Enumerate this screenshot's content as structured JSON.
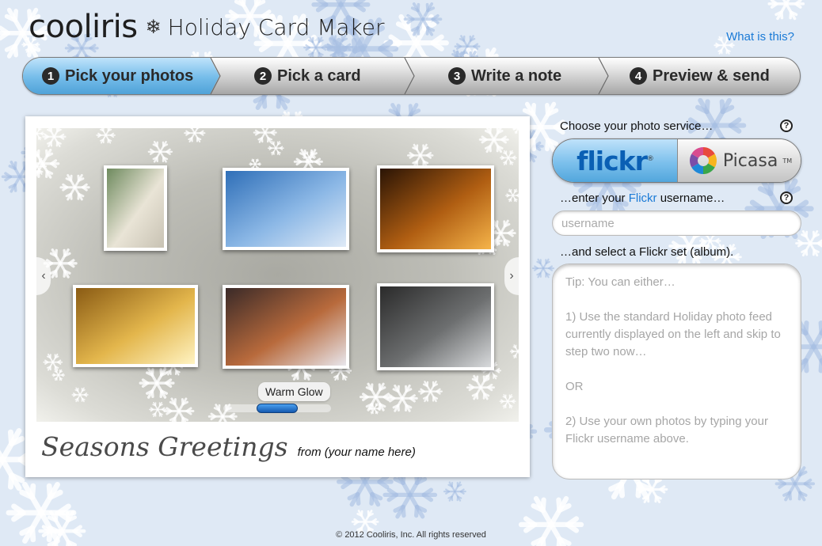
{
  "header": {
    "brand": "cooliris",
    "snowflake_glyph": "❄",
    "title": "Holiday Card Maker",
    "help_link": "What is this?"
  },
  "steps": [
    {
      "num": "1",
      "label": "Pick your photos",
      "active": true
    },
    {
      "num": "2",
      "label": "Pick a card",
      "active": false
    },
    {
      "num": "3",
      "label": "Write a note",
      "active": false
    },
    {
      "num": "4",
      "label": "Preview & send",
      "active": false
    }
  ],
  "photo_panel": {
    "photos": [
      {
        "name": "snowmen-photo",
        "colors": [
          "#6e8a5e",
          "#e9e4d6",
          "#c8c2b3"
        ]
      },
      {
        "name": "snowflake-photo",
        "colors": [
          "#2f6fb8",
          "#8cb8e6",
          "#dfeaf7"
        ]
      },
      {
        "name": "candles-photo",
        "colors": [
          "#2a1405",
          "#b05e12",
          "#f5b44a"
        ]
      },
      {
        "name": "gold-ornament-photo",
        "colors": [
          "#8a5b14",
          "#e3b64c",
          "#fff3c2"
        ]
      },
      {
        "name": "warm-glow-photo",
        "colors": [
          "#3a2a28",
          "#b86a3c",
          "#e8e6ec"
        ]
      },
      {
        "name": "icicles-photo",
        "colors": [
          "#2a2a2a",
          "#6d6f70",
          "#d8dadc"
        ]
      }
    ],
    "caption": "Warm Glow",
    "left_arrow_glyph": "‹",
    "right_arrow_glyph": "›",
    "greeting_title": "Seasons Greetings",
    "greeting_from": "from (your name here)"
  },
  "service": {
    "label": "Choose your photo service…",
    "help_glyph": "?",
    "options": {
      "flickr": "flickr",
      "picasa": "Picasa",
      "picasa_tm": "TM"
    },
    "selected": "flickr"
  },
  "username": {
    "label_before": "…enter your ",
    "label_service": "Flickr",
    "label_after": " username…",
    "placeholder": "username",
    "value": ""
  },
  "album": {
    "label": "…and select a Flickr set (album).",
    "tip_lines": [
      "Tip: You can either…",
      "1) Use the standard Holiday photo feed currently displayed on the left and skip to step two now…",
      "OR",
      "2) Use your own photos by typing your Flickr username above."
    ]
  },
  "colors": {
    "accent_blue": "#1a7ad6",
    "active_step": "#74bce9",
    "flickr_blue": "#0a5fb4"
  },
  "footer": "© 2012 Cooliris, Inc. All rights reserved"
}
